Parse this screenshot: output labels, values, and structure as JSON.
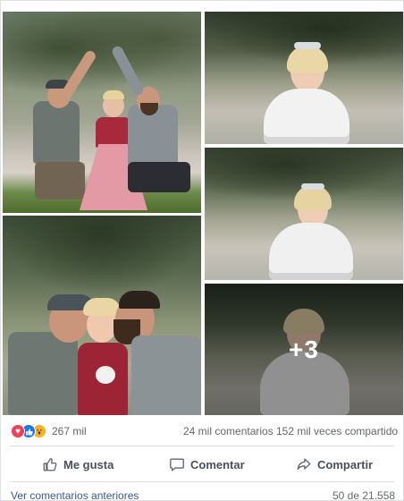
{
  "post": {
    "photos": [
      {
        "alt": "photo-1"
      },
      {
        "alt": "photo-2"
      },
      {
        "alt": "photo-3"
      },
      {
        "alt": "photo-4"
      },
      {
        "alt": "photo-5"
      }
    ],
    "more_photos_label": "+3"
  },
  "stats": {
    "reactions": {
      "icons": [
        "love-reaction-icon",
        "like-reaction-icon",
        "wow-reaction-icon"
      ],
      "count": "267 mil"
    },
    "comments": "24 mil comentarios",
    "shares": "152 mil veces compartido"
  },
  "actions": {
    "like_label": "Me gusta",
    "comment_label": "Comentar",
    "share_label": "Compartir"
  },
  "footer": {
    "previous_comments_label": "Ver comentarios anteriores",
    "pager": "50 de 21.558"
  },
  "colors": {
    "like_blue": "#1877f2",
    "love_red": "#f33e58",
    "wow_yellow": "#f7b125",
    "link_blue": "#385898",
    "muted_text": "#65676b"
  }
}
